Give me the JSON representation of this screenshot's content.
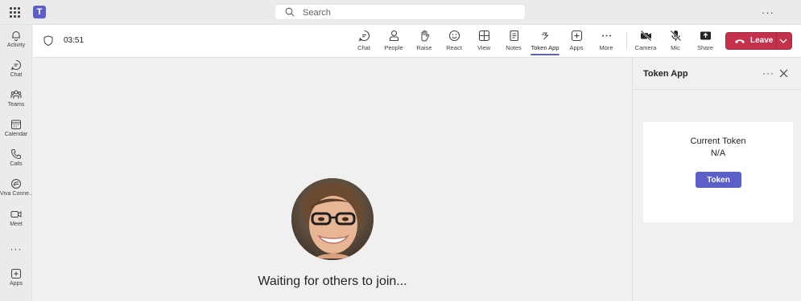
{
  "topbar": {
    "search_placeholder": "Search",
    "more": "···"
  },
  "rail": {
    "items": [
      {
        "label": "Activity",
        "icon": "bell-icon"
      },
      {
        "label": "Chat",
        "icon": "chat-icon"
      },
      {
        "label": "Teams",
        "icon": "teams-icon"
      },
      {
        "label": "Calendar",
        "icon": "calendar-icon"
      },
      {
        "label": "Calls",
        "icon": "phone-icon"
      },
      {
        "label": "Viva Conne...",
        "icon": "viva-connections-icon"
      },
      {
        "label": "Meet",
        "icon": "video-icon"
      },
      {
        "label": "Apps",
        "icon": "add-app-icon"
      }
    ],
    "more": "···"
  },
  "meeting": {
    "timer": "03:51",
    "toolbar": [
      {
        "label": "Chat",
        "icon": "chat-icon"
      },
      {
        "label": "People",
        "icon": "people-icon"
      },
      {
        "label": "Raise",
        "icon": "raise-hand-icon"
      },
      {
        "label": "React",
        "icon": "emoji-icon"
      },
      {
        "label": "View",
        "icon": "grid-view-icon"
      },
      {
        "label": "Notes",
        "icon": "notes-icon"
      },
      {
        "label": "Token App",
        "icon": "token-app-icon",
        "active": true
      },
      {
        "label": "Apps",
        "icon": "add-app-icon"
      },
      {
        "label": "More",
        "icon": "more-icon"
      },
      {
        "label": "Camera",
        "icon": "camera-off-icon"
      },
      {
        "label": "Mic",
        "icon": "mic-off-icon"
      },
      {
        "label": "Share",
        "icon": "share-icon"
      }
    ],
    "leave_label": "Leave",
    "accent": "#5b5fc7",
    "leave_color": "#c4314b"
  },
  "stage": {
    "waiting_text": "Waiting for others to join..."
  },
  "panel": {
    "title": "Token App",
    "more": "···",
    "card": {
      "heading": "Current Token",
      "value": "N/A",
      "button_label": "Token"
    }
  }
}
